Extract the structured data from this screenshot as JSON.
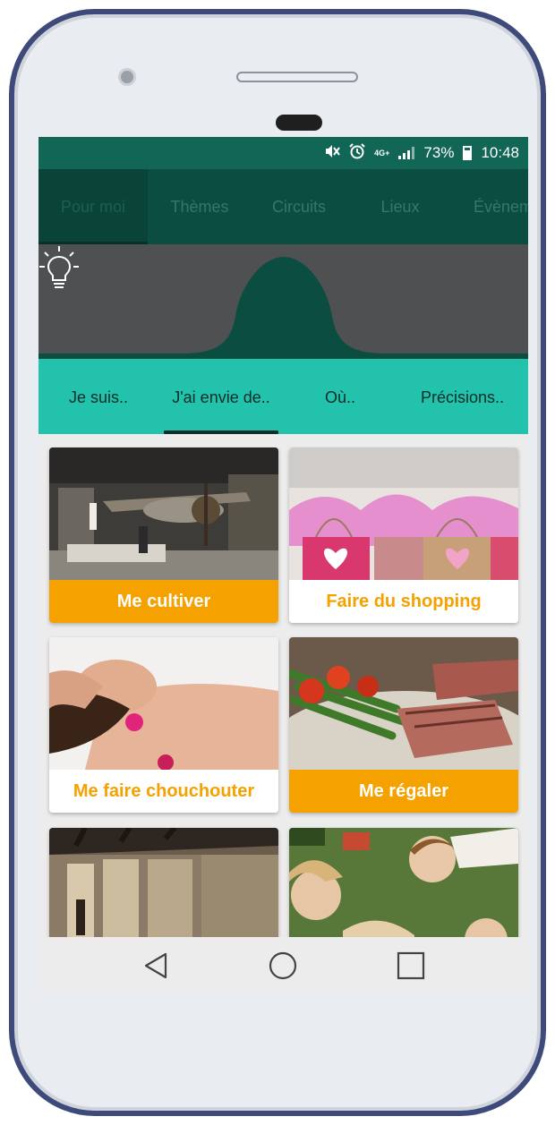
{
  "status_bar": {
    "battery": "73%",
    "time": "10:48",
    "network": "4G+",
    "icons": [
      "mute-icon",
      "alarm-icon",
      "signal-icon",
      "battery-icon"
    ]
  },
  "top_tabs": [
    {
      "label": "Pour moi",
      "active": true
    },
    {
      "label": "Thèmes",
      "active": false
    },
    {
      "label": "Circuits",
      "active": false
    },
    {
      "label": "Lieux",
      "active": false
    },
    {
      "label": "Évènem",
      "active": false
    }
  ],
  "hero": {
    "icon": "lightbulb-icon"
  },
  "sub_tabs": [
    {
      "label": "Je suis..",
      "active": false
    },
    {
      "label": "J'ai envie de..",
      "active": true
    },
    {
      "label": "Où..",
      "active": false
    },
    {
      "label": "Précisions..",
      "active": false
    }
  ],
  "cards": [
    {
      "label": "Me cultiver",
      "label_style": "orange",
      "image": "museum-airplane-photo"
    },
    {
      "label": "Faire du shopping",
      "label_style": "white",
      "image": "shopping-bags-photo"
    },
    {
      "label": "Me faire chouchouter",
      "label_style": "white",
      "image": "spa-massage-photo"
    },
    {
      "label": "Me régaler",
      "label_style": "orange",
      "image": "steak-asparagus-photo"
    },
    {
      "label": "",
      "label_style": "white",
      "image": "exhibition-hall-photo"
    },
    {
      "label": "",
      "label_style": "white",
      "image": "children-lying-grass-photo"
    }
  ],
  "nav_bar": {
    "icons": [
      "back-icon",
      "home-icon",
      "recents-icon"
    ]
  },
  "colors": {
    "accent_orange": "#f5a100",
    "status_green": "#126656",
    "nav_dark_green": "#0c4d41",
    "subnav_teal": "#22c2ac",
    "hero_grey": "#4f5051",
    "phone_frame": "#3d4a7a"
  }
}
